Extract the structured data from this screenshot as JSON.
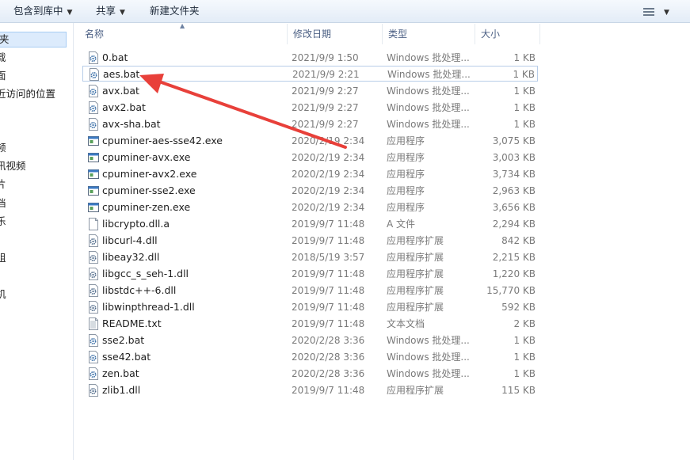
{
  "toolbar": {
    "include_library": "包含到库中",
    "share": "共享",
    "new_folder": "新建文件夹"
  },
  "nav": {
    "items": [
      "夹",
      "载",
      "面",
      "近访问的位置",
      "频",
      "讯视频",
      "片",
      "档",
      "乐",
      "组",
      "机"
    ]
  },
  "columns": {
    "name": "名称",
    "date": "修改日期",
    "type": "类型",
    "size": "大小"
  },
  "files": [
    {
      "name": "0.bat",
      "date": "2021/9/9 1:50",
      "type": "Windows 批处理...",
      "size": "1 KB",
      "icon": "bat-gear-icon"
    },
    {
      "name": "aes.bat",
      "date": "2021/9/9 2:21",
      "type": "Windows 批处理...",
      "size": "1 KB",
      "icon": "bat-gear-icon"
    },
    {
      "name": "avx.bat",
      "date": "2021/9/9 2:27",
      "type": "Windows 批处理...",
      "size": "1 KB",
      "icon": "bat-gear-icon"
    },
    {
      "name": "avx2.bat",
      "date": "2021/9/9 2:27",
      "type": "Windows 批处理...",
      "size": "1 KB",
      "icon": "bat-gear-icon"
    },
    {
      "name": "avx-sha.bat",
      "date": "2021/9/9 2:27",
      "type": "Windows 批处理...",
      "size": "1 KB",
      "icon": "bat-gear-icon"
    },
    {
      "name": "cpuminer-aes-sse42.exe",
      "date": "2020/2/19 2:34",
      "type": "应用程序",
      "size": "3,075 KB",
      "icon": "exe-window-icon"
    },
    {
      "name": "cpuminer-avx.exe",
      "date": "2020/2/19 2:34",
      "type": "应用程序",
      "size": "3,003 KB",
      "icon": "exe-window-icon"
    },
    {
      "name": "cpuminer-avx2.exe",
      "date": "2020/2/19 2:34",
      "type": "应用程序",
      "size": "3,734 KB",
      "icon": "exe-window-icon"
    },
    {
      "name": "cpuminer-sse2.exe",
      "date": "2020/2/19 2:34",
      "type": "应用程序",
      "size": "2,963 KB",
      "icon": "exe-window-icon"
    },
    {
      "name": "cpuminer-zen.exe",
      "date": "2020/2/19 2:34",
      "type": "应用程序",
      "size": "3,656 KB",
      "icon": "exe-window-icon"
    },
    {
      "name": "libcrypto.dll.a",
      "date": "2019/9/7 11:48",
      "type": "A 文件",
      "size": "2,294 KB",
      "icon": "blank-file-icon"
    },
    {
      "name": "libcurl-4.dll",
      "date": "2019/9/7 11:48",
      "type": "应用程序扩展",
      "size": "842 KB",
      "icon": "dll-gear-icon"
    },
    {
      "name": "libeay32.dll",
      "date": "2018/5/19 3:57",
      "type": "应用程序扩展",
      "size": "2,215 KB",
      "icon": "dll-gear-icon"
    },
    {
      "name": "libgcc_s_seh-1.dll",
      "date": "2019/9/7 11:48",
      "type": "应用程序扩展",
      "size": "1,220 KB",
      "icon": "dll-gear-icon"
    },
    {
      "name": "libstdc++-6.dll",
      "date": "2019/9/7 11:48",
      "type": "应用程序扩展",
      "size": "15,770 KB",
      "icon": "dll-gear-icon"
    },
    {
      "name": "libwinpthread-1.dll",
      "date": "2019/9/7 11:48",
      "type": "应用程序扩展",
      "size": "592 KB",
      "icon": "dll-gear-icon"
    },
    {
      "name": "README.txt",
      "date": "2019/9/7 11:48",
      "type": "文本文档",
      "size": "2 KB",
      "icon": "text-file-icon"
    },
    {
      "name": "sse2.bat",
      "date": "2020/2/28 3:36",
      "type": "Windows 批处理...",
      "size": "1 KB",
      "icon": "bat-gear-icon"
    },
    {
      "name": "sse42.bat",
      "date": "2020/2/28 3:36",
      "type": "Windows 批处理...",
      "size": "1 KB",
      "icon": "bat-gear-icon"
    },
    {
      "name": "zen.bat",
      "date": "2020/2/28 3:36",
      "type": "Windows 批处理...",
      "size": "1 KB",
      "icon": "bat-gear-icon"
    },
    {
      "name": "zlib1.dll",
      "date": "2019/9/7 11:48",
      "type": "应用程序扩展",
      "size": "115 KB",
      "icon": "dll-gear-icon"
    }
  ],
  "selected_file": "aes.bat",
  "annotation_arrow_color": "#e8403a"
}
